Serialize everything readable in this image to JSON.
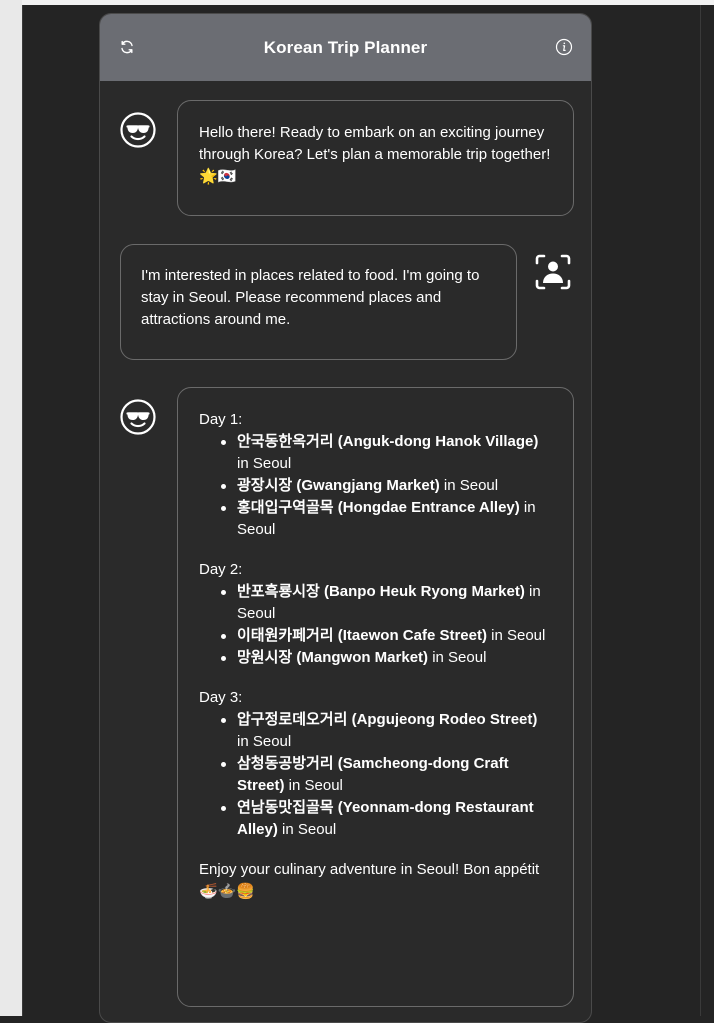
{
  "header": {
    "title": "Korean Trip Planner",
    "refresh_icon": "refresh-icon",
    "info_icon": "info-icon"
  },
  "messages": [
    {
      "role": "assistant",
      "avatar_icon": "sunglasses-face-icon",
      "text": "Hello there! Ready to embark on an exciting journey through Korea? Let's plan a memorable trip together! 🌟🇰🇷"
    },
    {
      "role": "user",
      "avatar_icon": "user-scan-icon",
      "text": "I'm interested in places related to food. I'm going to stay in Seoul. Please recommend places and attractions around me."
    },
    {
      "role": "assistant",
      "avatar_icon": "sunglasses-face-icon",
      "days": [
        {
          "title": "Day 1:",
          "items": [
            {
              "name": "안국동한옥거리 (Anguk-dong Hanok Village)",
              "suffix": " in Seoul"
            },
            {
              "name": "광장시장 (Gwangjang Market)",
              "suffix": " in Seoul"
            },
            {
              "name": "홍대입구역골목 (Hongdae Entrance Alley)",
              "suffix": " in Seoul"
            }
          ]
        },
        {
          "title": "Day 2:",
          "items": [
            {
              "name": "반포흑룡시장 (Banpo Heuk Ryong Market)",
              "suffix": " in Seoul"
            },
            {
              "name": "이태원카페거리 (Itaewon Cafe Street)",
              "suffix": " in Seoul"
            },
            {
              "name": "망원시장 (Mangwon Market)",
              "suffix": " in Seoul"
            }
          ]
        },
        {
          "title": "Day 3:",
          "items": [
            {
              "name": "압구정로데오거리 (Apgujeong Rodeo Street)",
              "suffix": " in Seoul"
            },
            {
              "name": "삼청동공방거리 (Samcheong-dong Craft Street)",
              "suffix": " in Seoul"
            },
            {
              "name": "연남동맛집골목 (Yeonnam-dong Restaurant Alley)",
              "suffix": " in Seoul"
            }
          ]
        }
      ],
      "closing": "Enjoy your culinary adventure in Seoul! Bon appétit 🍜🍲🍔"
    }
  ]
}
